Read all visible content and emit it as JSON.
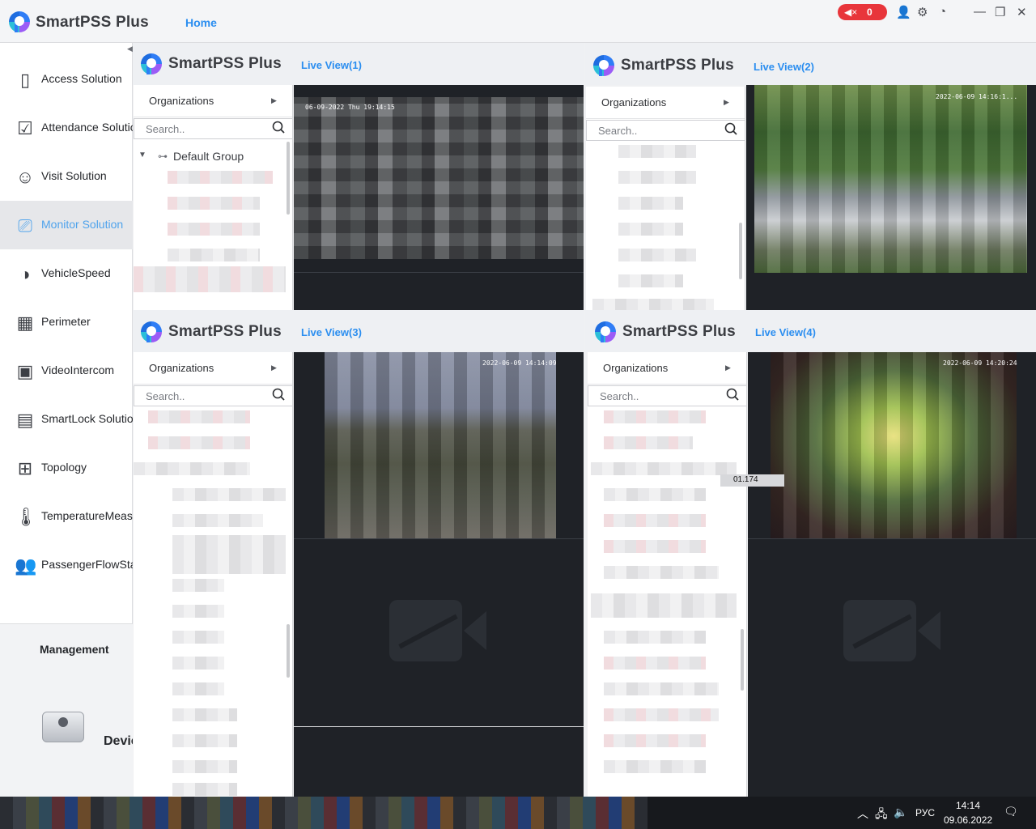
{
  "app": {
    "brand": "SmartPSS Plus",
    "home_tab": "Home",
    "alarm_count": "0"
  },
  "sidebar": {
    "items": [
      {
        "label": "Access Solution",
        "icon": "door-icon"
      },
      {
        "label": "Attendance Solution",
        "icon": "calendar-check-icon"
      },
      {
        "label": "Visit Solution",
        "icon": "visitor-icon"
      },
      {
        "label": "Monitor Solution",
        "icon": "cctv-camera-icon"
      },
      {
        "label": "VehicleSpeed",
        "icon": "speedometer-icon"
      },
      {
        "label": "Perimeter",
        "icon": "perimeter-icon"
      },
      {
        "label": "VideoIntercom",
        "icon": "intercom-icon"
      },
      {
        "label": "SmartLock Solution",
        "icon": "smartlock-icon"
      },
      {
        "label": "Topology",
        "icon": "topology-icon"
      },
      {
        "label": "TemperatureMeasurement",
        "icon": "thermometer-icon"
      },
      {
        "label": "PassengerFlowStatistics",
        "icon": "people-icon"
      }
    ],
    "active": "Monitor Solution",
    "management_title": "Management",
    "device_label": "Devices"
  },
  "panels": [
    {
      "brand": "SmartPSS Plus",
      "tab": "Live View(1)",
      "organizations": "Organizations",
      "search_placeholder": "Search..",
      "group": "Default Group",
      "osd": "06-09-2022 Thu 19:14:15"
    },
    {
      "brand": "SmartPSS Plus",
      "tab": "Live View(2)",
      "organizations": "Organizations",
      "search_placeholder": "Search..",
      "osd": "2022-06-09 14:16:1..."
    },
    {
      "brand": "SmartPSS Plus",
      "tab": "Live View(3)",
      "organizations": "Organizations",
      "search_placeholder": "Search..",
      "osd": "2022-06-09 14:14:09"
    },
    {
      "brand": "SmartPSS Plus",
      "tab": "Live View(4)",
      "organizations": "Organizations",
      "search_placeholder": "Search..",
      "osd": "2022-06-09 14:20:24",
      "tooltip": "01.174"
    }
  ],
  "taskbar": {
    "language": "РУС",
    "time": "14:14",
    "date": "09.06.2022"
  }
}
